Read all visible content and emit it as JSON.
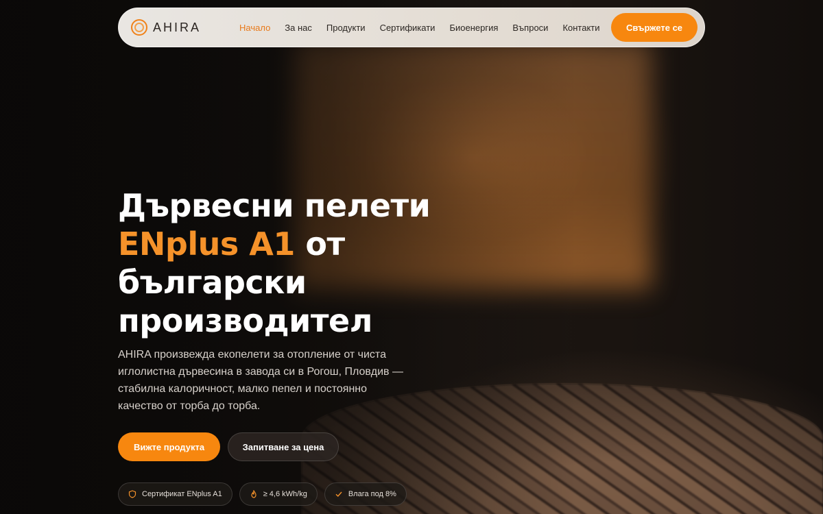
{
  "brand": {
    "name": "AHIRA",
    "accent_color": "#f7870f"
  },
  "nav": {
    "items": [
      {
        "label": "Начало",
        "active": true
      },
      {
        "label": "За нас",
        "active": false
      },
      {
        "label": "Продукти",
        "active": false
      },
      {
        "label": "Сертификати",
        "active": false
      },
      {
        "label": "Биоенергия",
        "active": false
      },
      {
        "label": "Въпроси",
        "active": false
      },
      {
        "label": "Контакти",
        "active": false
      }
    ],
    "cta_label": "Свържете се"
  },
  "hero": {
    "title_line1": "Дървесни пелети",
    "title_accent": "ENplus A1",
    "title_after_accent": " от",
    "title_line3": "български",
    "title_line4": "производител",
    "description": "AHIRA произвежда екопелети за отопление от чиста иглолистна дървесина в завода си в Рогош, Пловдив — стабилна калоричност, малко пепел и постоянно качество от торба до торба.",
    "primary_button": "Вижте продукта",
    "secondary_button": "Запитване за цена",
    "badges": [
      {
        "icon": "shield-icon",
        "label": "Сертификат ENplus A1"
      },
      {
        "icon": "flame-icon",
        "label": "≥ 4,6 kWh/kg"
      },
      {
        "icon": "check-icon",
        "label": "Влага под 8%"
      }
    ]
  }
}
